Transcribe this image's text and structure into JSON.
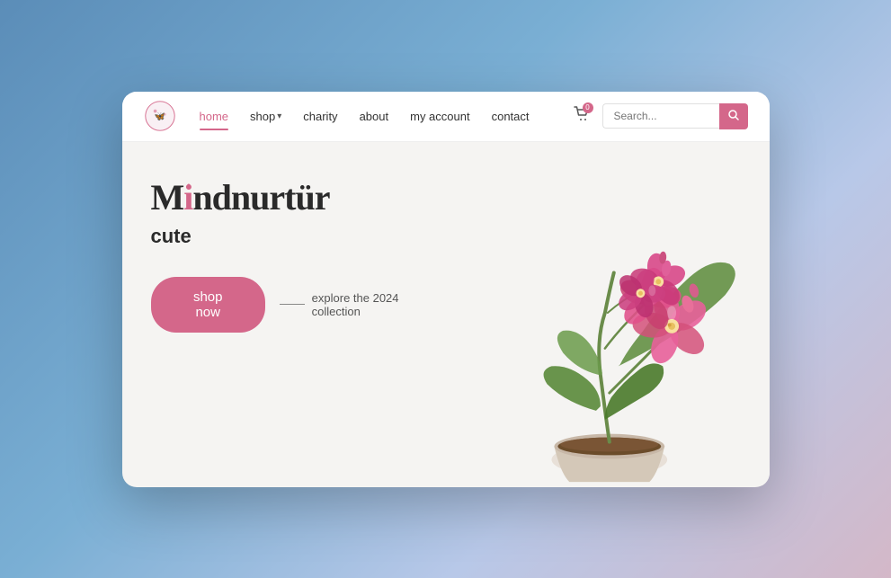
{
  "meta": {
    "title": "Mindnurtür",
    "background": "#5b8db8"
  },
  "navbar": {
    "logo_alt": "Mindnurtür logo",
    "nav_links": [
      {
        "id": "home",
        "label": "home",
        "active": true,
        "has_dropdown": false
      },
      {
        "id": "shop",
        "label": "shop",
        "active": false,
        "has_dropdown": true
      },
      {
        "id": "charity",
        "label": "charity",
        "active": false,
        "has_dropdown": false
      },
      {
        "id": "about",
        "label": "about",
        "active": false,
        "has_dropdown": false
      },
      {
        "id": "my-account",
        "label": "my account",
        "active": false,
        "has_dropdown": false
      },
      {
        "id": "contact",
        "label": "contact",
        "active": false,
        "has_dropdown": false
      }
    ],
    "cart_badge": "0",
    "search_placeholder": "Search..."
  },
  "hero": {
    "brand_title": "Mindnurtür",
    "subtitle": "cute",
    "shop_now_label": "shop now",
    "explore_label": "explore the 2024 collection"
  }
}
